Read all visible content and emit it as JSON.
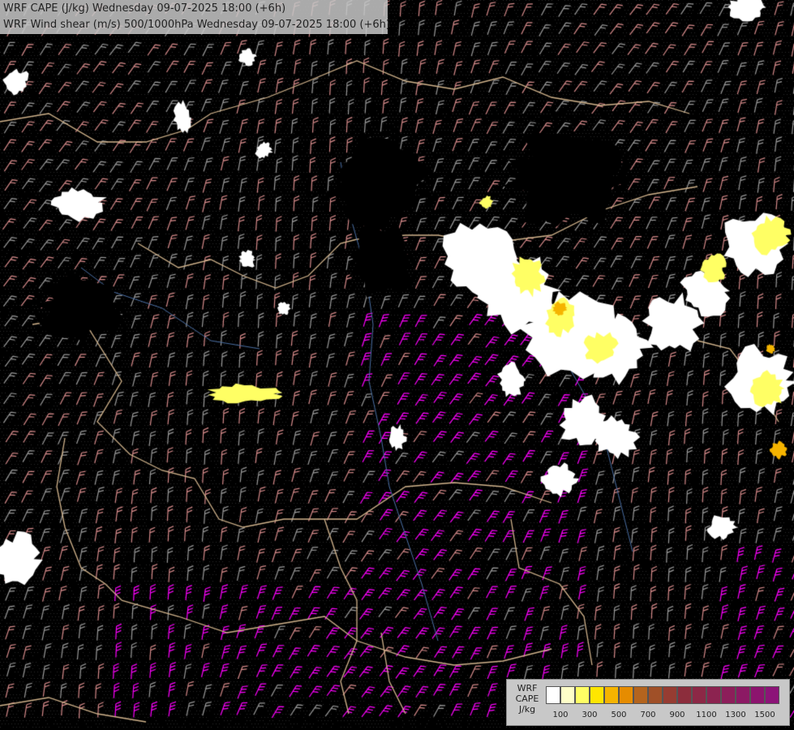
{
  "header": {
    "line1": "WRF CAPE (J/kg) Wednesday 09-07-2025 18:00 (+6h)",
    "line2": "WRF Wind shear (m/s) 500/1000hPa Wednesday 09-07-2025 18:00 (+6h)"
  },
  "legend": {
    "title_line1": "WRF",
    "title_line2": "CAPE",
    "title_line3": "J/kg",
    "colors": [
      "#ffffff",
      "#ffffc8",
      "#ffff64",
      "#ffe600",
      "#f5b400",
      "#e68c00",
      "#b4641e",
      "#a05028",
      "#963c32",
      "#8c2d3c",
      "#8c2846",
      "#8c2350",
      "#8c1e5a",
      "#8c1964",
      "#8c146e",
      "#8c1478"
    ],
    "ticks": [
      "100",
      "300",
      "500",
      "700",
      "900",
      "1100",
      "1300",
      "1500"
    ]
  },
  "map_colors": {
    "background": "#000000",
    "border": "#d2b48c",
    "river": "#4a6fa5",
    "barb_gray": "#9a9a9a",
    "barb_pink": "#d68a8a",
    "barb_magenta": "#ff00ff",
    "cape_low": "#ffffff",
    "cape_mid": "#ffff64",
    "cape_high": "#f5b400"
  }
}
